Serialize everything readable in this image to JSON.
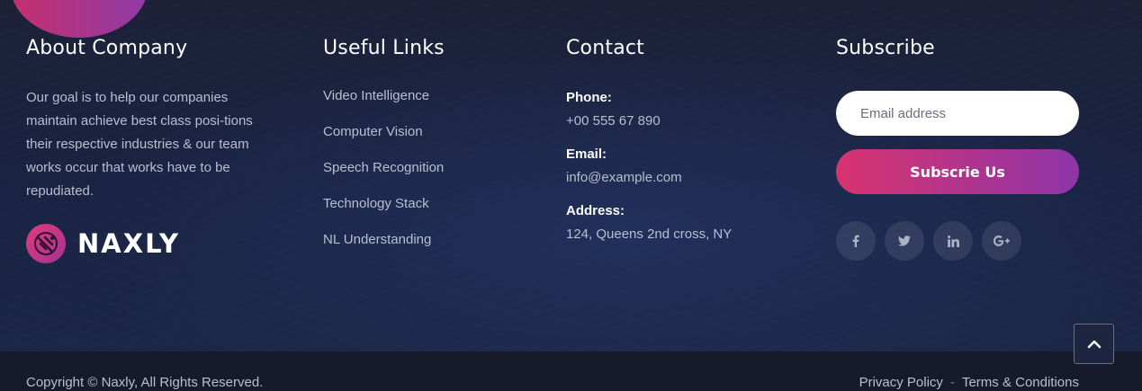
{
  "about": {
    "heading": "About Company",
    "text": "Our goal is to help our companies maintain achieve best class posi-tions their respective industries & our team works occur that works have to be repudiated.",
    "logo_text": "NAXLY"
  },
  "links": {
    "heading": "Useful Links",
    "items": [
      {
        "label": "Video Intelligence"
      },
      {
        "label": "Computer Vision"
      },
      {
        "label": "Speech Recognition"
      },
      {
        "label": "Technology Stack"
      },
      {
        "label": "NL Understanding"
      }
    ]
  },
  "contact": {
    "heading": "Contact",
    "items": [
      {
        "label": "Phone:",
        "value": "+00 555 67 890"
      },
      {
        "label": "Email:",
        "value": "info@example.com"
      },
      {
        "label": "Address:",
        "value": "124, Queens 2nd cross, NY"
      }
    ]
  },
  "subscribe": {
    "heading": "Subscribe",
    "placeholder": "Email address",
    "button_label": "Subscrie Us",
    "socials": [
      {
        "icon": "facebook-icon",
        "glyph": "f"
      },
      {
        "icon": "twitter-icon",
        "glyph": "t"
      },
      {
        "icon": "linkedin-icon",
        "glyph": "in"
      },
      {
        "icon": "google-plus-icon",
        "glyph": "G+"
      }
    ]
  },
  "bottom": {
    "copyright": "Copyright © Naxly, All Rights Reserved.",
    "privacy": "Privacy Policy",
    "separator": "-",
    "terms": "Terms & Conditions"
  },
  "colors": {
    "accent_start": "#d8336f",
    "accent_end": "#8d35a8",
    "background": "#1b2036"
  }
}
